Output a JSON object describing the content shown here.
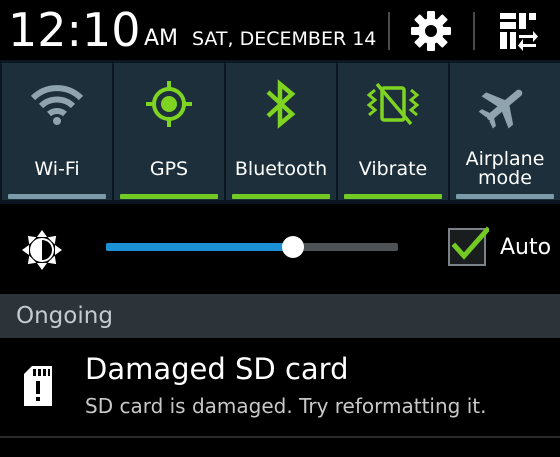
{
  "status_bar": {
    "time": "12:10",
    "ampm": "AM",
    "date": "SAT, DECEMBER 14"
  },
  "quick_settings": [
    {
      "id": "wifi",
      "label": "Wi-Fi",
      "icon": "wifi-icon",
      "active": false
    },
    {
      "id": "gps",
      "label": "GPS",
      "icon": "gps-icon",
      "active": true
    },
    {
      "id": "bluetooth",
      "label": "Bluetooth",
      "icon": "bluetooth-icon",
      "active": true
    },
    {
      "id": "vibrate",
      "label": "Vibrate",
      "icon": "vibrate-icon",
      "active": true
    },
    {
      "id": "airplane",
      "label_line1": "Airplane",
      "label_line2": "mode",
      "icon": "airplane-icon",
      "active": false
    }
  ],
  "brightness": {
    "level": 0.64,
    "auto_label": "Auto",
    "auto_checked": true
  },
  "ongoing": {
    "header": "Ongoing"
  },
  "notification": {
    "title": "Damaged SD card",
    "text": "SD card is damaged. Try reformatting it.",
    "icon": "sd-card-icon"
  },
  "colors": {
    "active_indicator": "#73ca22",
    "inactive_indicator": "#7c9ba8",
    "active_icon": "#7fd321",
    "inactive_icon": "#8fa4ae",
    "slider_fill": "#1b91d4",
    "tile_background": "#1c2f3a"
  }
}
